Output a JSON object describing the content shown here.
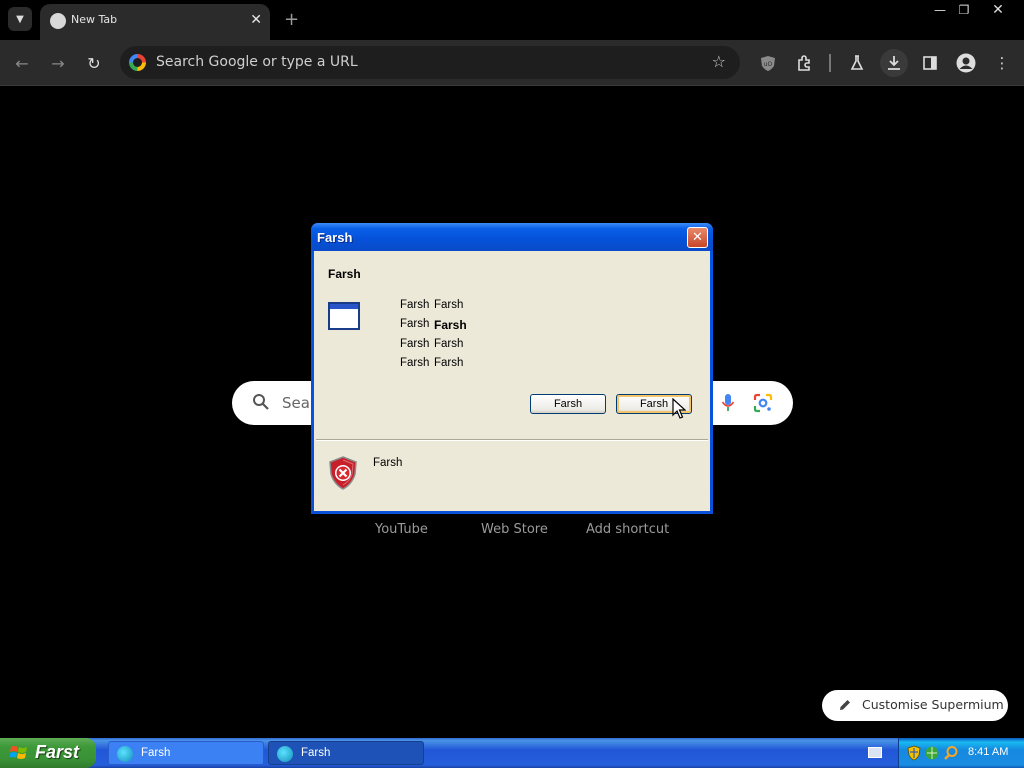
{
  "browser": {
    "tab_title": "New Tab",
    "omnibox_placeholder": "Search Google or type a URL"
  },
  "ntp": {
    "search_placeholder": "Sear",
    "shortcuts": [
      "YouTube",
      "Web Store",
      "Add shortcut"
    ],
    "customise_label": "Customise Supermium"
  },
  "dialog": {
    "title": "Farsh",
    "heading": "Farsh",
    "properties": [
      {
        "label": "Farsh",
        "value": "Farsh",
        "bold": false
      },
      {
        "label": "Farsh",
        "value": "Farsh",
        "bold": true
      },
      {
        "label": "Farsh",
        "value": "Farsh",
        "bold": false
      },
      {
        "label": "Farsh",
        "value": "Farsh",
        "bold": false
      }
    ],
    "button1": "Farsh",
    "button2": "Farsh",
    "footer_text": "Farsh"
  },
  "taskbar": {
    "start_label": "Farst",
    "items": [
      "Farsh",
      "Farsh"
    ],
    "clock": "8:41 AM"
  },
  "colors": {
    "xp_blue": "#0a5fe8",
    "dialog_bg": "#ece9d8",
    "start_green": "#3c9939"
  }
}
